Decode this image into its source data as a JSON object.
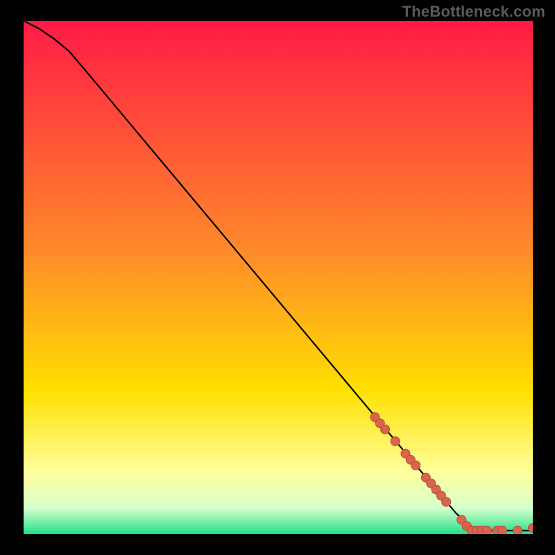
{
  "watermark": "TheBottleneck.com",
  "colors": {
    "gradient_top": "#ff1a45",
    "gradient_mid_yellow": "#ffe000",
    "gradient_pale_yellow": "#ffff9e",
    "gradient_green": "#21e08a",
    "curve": "#000000",
    "point_fill": "#d8654d",
    "point_stroke": "#b94a3c"
  },
  "chart_data": {
    "type": "line",
    "title": "",
    "xlabel": "",
    "ylabel": "",
    "xlim": [
      0,
      100
    ],
    "ylim": [
      0,
      100
    ],
    "curve": [
      {
        "x": 0,
        "y": 100
      },
      {
        "x": 3,
        "y": 98.5
      },
      {
        "x": 6,
        "y": 96.5
      },
      {
        "x": 9,
        "y": 94
      },
      {
        "x": 12,
        "y": 90.5
      },
      {
        "x": 85,
        "y": 4
      },
      {
        "x": 88,
        "y": 1.5
      },
      {
        "x": 92,
        "y": 0.7
      },
      {
        "x": 100,
        "y": 0.7
      }
    ],
    "points": [
      {
        "x": 69,
        "y": 22.8
      },
      {
        "x": 70,
        "y": 21.6
      },
      {
        "x": 71,
        "y": 20.4
      },
      {
        "x": 73,
        "y": 18.1
      },
      {
        "x": 75,
        "y": 15.7
      },
      {
        "x": 76,
        "y": 14.5
      },
      {
        "x": 77,
        "y": 13.4
      },
      {
        "x": 79,
        "y": 11.0
      },
      {
        "x": 80,
        "y": 9.9
      },
      {
        "x": 81,
        "y": 8.7
      },
      {
        "x": 82,
        "y": 7.5
      },
      {
        "x": 83,
        "y": 6.3
      },
      {
        "x": 86,
        "y": 2.8
      },
      {
        "x": 87,
        "y": 1.6
      },
      {
        "x": 88,
        "y": 0.7
      },
      {
        "x": 89,
        "y": 0.7
      },
      {
        "x": 90,
        "y": 0.7
      },
      {
        "x": 91,
        "y": 0.7
      },
      {
        "x": 93,
        "y": 0.7
      },
      {
        "x": 94,
        "y": 0.7
      },
      {
        "x": 97,
        "y": 0.7
      },
      {
        "x": 100,
        "y": 1.2
      }
    ]
  }
}
